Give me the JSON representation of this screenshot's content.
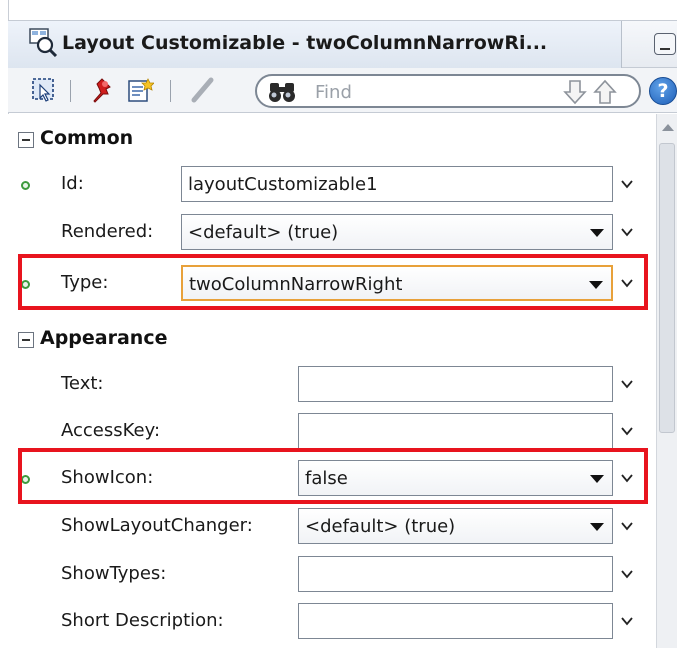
{
  "window": {
    "title": "Layout Customizable - twoColumnNarrowRi..."
  },
  "toolbar": {
    "find_placeholder": "Find",
    "help_label": "?"
  },
  "sections": {
    "common": {
      "label": "Common"
    },
    "appearance": {
      "label": "Appearance"
    }
  },
  "properties": {
    "id": {
      "label": "Id:",
      "value": "layoutCustomizable1"
    },
    "rendered": {
      "label": "Rendered:",
      "value": "<default> (true)"
    },
    "type": {
      "label": "Type:",
      "value": "twoColumnNarrowRight"
    },
    "text": {
      "label": "Text:",
      "value": ""
    },
    "accesskey": {
      "label": "AccessKey:",
      "value": ""
    },
    "showicon": {
      "label": "ShowIcon:",
      "value": "false"
    },
    "showlayoutchanger": {
      "label": "ShowLayoutChanger:",
      "value": "<default> (true)"
    },
    "showtypes": {
      "label": "ShowTypes:",
      "value": ""
    },
    "shortdescription": {
      "label": "Short Description:",
      "value": ""
    }
  },
  "colors": {
    "highlight": "#e8141e",
    "required_dot": "#3d9a3d",
    "focus_border": "#e8a13a"
  }
}
